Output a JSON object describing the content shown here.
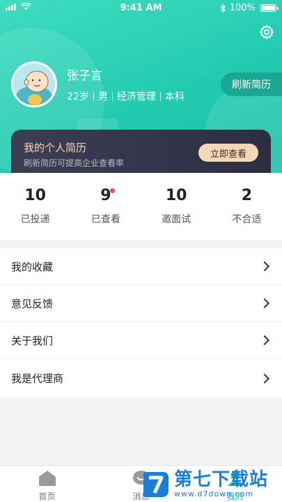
{
  "status_bar": {
    "time": "9:41 AM",
    "battery": "100%"
  },
  "profile": {
    "name": "张子言",
    "age": "22岁",
    "gender": "男",
    "major": "经济管理",
    "degree": "本科",
    "refresh_label": "刷新简历"
  },
  "resume_card": {
    "title": "我的个人简历",
    "subtitle": "刷新简历可提高企业查看率",
    "button_label": "立即查看"
  },
  "stats": [
    {
      "value": "10",
      "label": "已投递"
    },
    {
      "value": "9",
      "label": "已查看",
      "has_badge": true
    },
    {
      "value": "10",
      "label": "邀面试"
    },
    {
      "value": "2",
      "label": "不合适"
    }
  ],
  "menu": [
    {
      "label": "我的收藏"
    },
    {
      "label": "意见反馈"
    },
    {
      "label": "关于我们"
    },
    {
      "label": "我是代理商"
    }
  ],
  "tabbar": [
    {
      "label": "首页",
      "icon": "home-icon"
    },
    {
      "label": "消息",
      "icon": "message-icon"
    },
    {
      "label": "我的",
      "icon": "profile-icon",
      "active": true
    }
  ],
  "watermark": {
    "title": "第七下载站",
    "url": "www.d7down.com"
  },
  "colors": {
    "accent": "#19c2a6",
    "card_dark": "#2d2e42",
    "card_gold": "#f5d7b6",
    "badge": "#f24d4d"
  }
}
